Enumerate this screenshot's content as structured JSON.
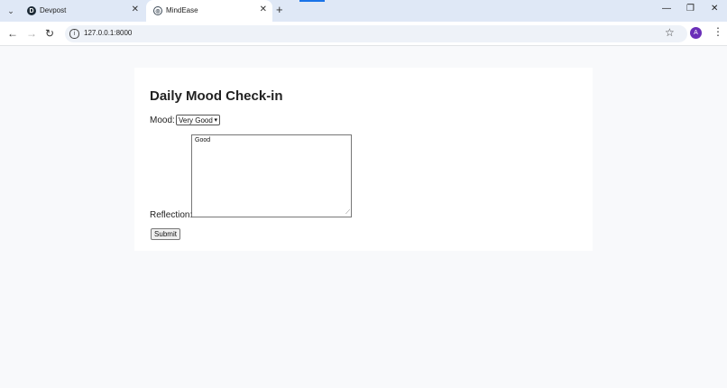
{
  "browser": {
    "tabs": [
      {
        "title": "Devpost",
        "favicon": "D"
      },
      {
        "title": "MindEase",
        "favicon": "◎"
      }
    ],
    "url": "127.0.0.1:8000",
    "profile_initial": "A",
    "colors": {
      "tabbar": "#dfe8f6",
      "avatar": "#6a2fb8"
    }
  },
  "page": {
    "heading": "Daily Mood Check-in",
    "mood_label": "Mood:",
    "mood_value": "Very Good",
    "reflection_label": "Reflection:",
    "reflection_value": "Good",
    "submit_label": "Submit"
  }
}
